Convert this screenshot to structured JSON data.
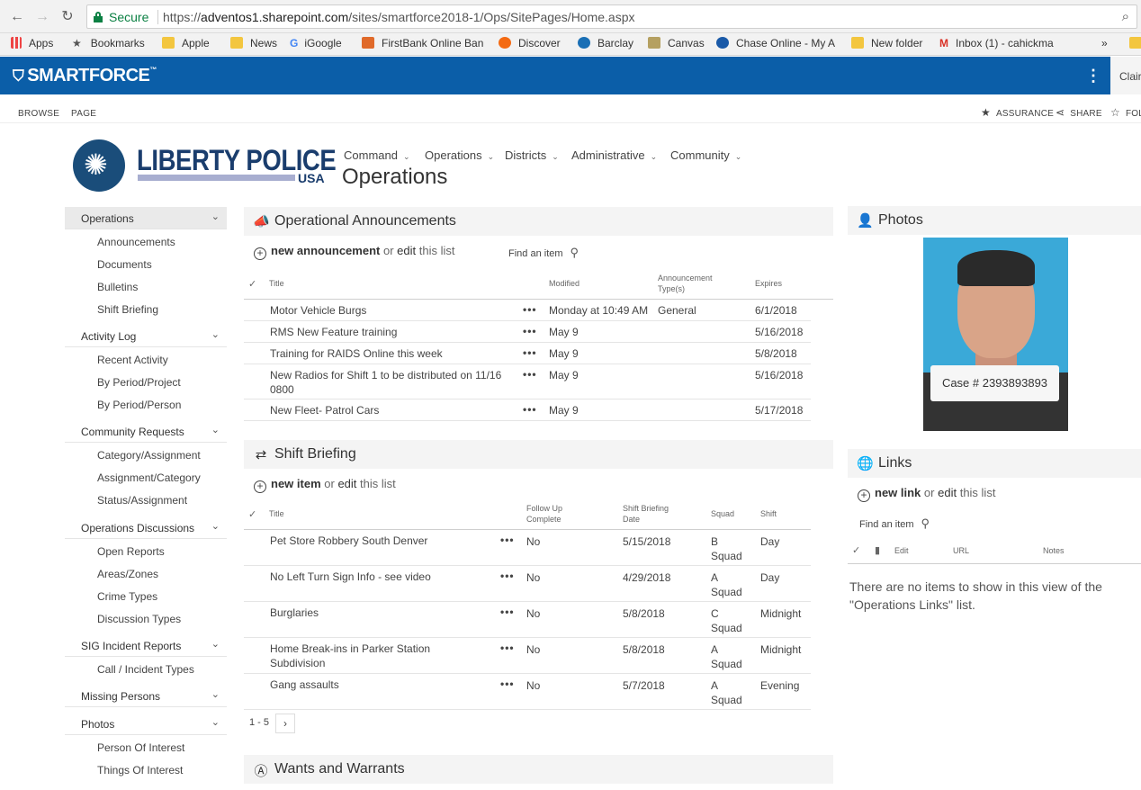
{
  "browser": {
    "secure_label": "Secure",
    "url_prefix": "https://",
    "url_host": "adventos1.sharepoint.com",
    "url_path": "/sites/smartforce2018-1/Ops/SitePages/Home.aspx",
    "bookmarks": [
      "Apps",
      "Bookmarks",
      "Apple",
      "News",
      "iGoogle",
      "FirstBank Online Ban",
      "Discover",
      "Barclay",
      "Canvas",
      "Chase Online - My A",
      "New folder",
      "Inbox (1) - cahickma"
    ],
    "more": "»"
  },
  "suite": {
    "brand": "SMARTFORCE",
    "tm": "™",
    "user": "Clair"
  },
  "ribbon": {
    "tabs": [
      "BROWSE",
      "PAGE"
    ],
    "actions": [
      "ASSURANCE",
      "SHARE",
      "FOL"
    ]
  },
  "header": {
    "logo_main": "LIBERTY POLICE",
    "logo_sub": "USA",
    "nav": [
      "Command",
      "Operations",
      "Districts",
      "Administrative",
      "Community"
    ],
    "site_title": "Operations"
  },
  "leftnav": {
    "sections": [
      {
        "label": "Operations",
        "items": [
          "Announcements",
          "Documents",
          "Bulletins",
          "Shift Briefing"
        ]
      },
      {
        "label": "Activity Log",
        "items": [
          "Recent Activity",
          "By Period/Project",
          "By Period/Person"
        ]
      },
      {
        "label": "Community Requests",
        "items": [
          "Category/Assignment",
          "Assignment/Category",
          "Status/Assignment"
        ]
      },
      {
        "label": "Operations Discussions",
        "items": [
          "Open Reports",
          "Areas/Zones",
          "Crime Types",
          "Discussion Types"
        ]
      },
      {
        "label": "SIG Incident Reports",
        "items": [
          "Call / Incident Types"
        ]
      },
      {
        "label": "Missing Persons",
        "items": []
      },
      {
        "label": "Photos",
        "items": [
          "Person Of Interest",
          "Things Of Interest"
        ]
      }
    ]
  },
  "announcements": {
    "title": "Operational Announcements",
    "new_label": "new announcement",
    "or": "or",
    "edit": "edit",
    "this_list": "this list",
    "find": "Find an item",
    "columns": [
      "Title",
      "Modified",
      "Announcement Type(s)",
      "Expires"
    ],
    "rows": [
      {
        "title": "Motor Vehicle Burgs",
        "modified": "Monday at 10:49 AM",
        "type": "General",
        "expires": "6/1/2018"
      },
      {
        "title": "RMS New Feature training",
        "modified": "May 9",
        "type": "",
        "expires": "5/16/2018"
      },
      {
        "title": "Training for RAIDS Online this week",
        "modified": "May 9",
        "type": "",
        "expires": "5/8/2018"
      },
      {
        "title": "New Radios for Shift 1 to be distributed on 11/16 0800",
        "modified": "May 9",
        "type": "",
        "expires": "5/16/2018"
      },
      {
        "title": "New Fleet- Patrol Cars",
        "modified": "May 9",
        "type": "",
        "expires": "5/17/2018"
      }
    ]
  },
  "shift": {
    "title": "Shift Briefing",
    "new_label": "new item",
    "or": "or",
    "edit": "edit",
    "this_list": "this list",
    "columns": [
      "Title",
      "Follow Up Complete",
      "Shift Briefing Date",
      "Squad",
      "Shift"
    ],
    "rows": [
      {
        "title": "Pet Store Robbery South Denver",
        "follow": "No",
        "date": "5/15/2018",
        "squad": "B Squad",
        "shift": "Day"
      },
      {
        "title": "No Left Turn Sign Info - see video",
        "follow": "No",
        "date": "4/29/2018",
        "squad": "A Squad",
        "shift": "Day"
      },
      {
        "title": "Burglaries",
        "follow": "No",
        "date": "5/8/2018",
        "squad": "C Squad",
        "shift": "Midnight"
      },
      {
        "title": "Home Break-ins in Parker Station Subdivision",
        "follow": "No",
        "date": "5/8/2018",
        "squad": "A Squad",
        "shift": "Midnight"
      },
      {
        "title": "Gang assaults",
        "follow": "No",
        "date": "5/7/2018",
        "squad": "A Squad",
        "shift": "Evening"
      }
    ],
    "pager": "1 - 5",
    "next": "›"
  },
  "wants": {
    "title": "Wants and Warrants"
  },
  "photos": {
    "title": "Photos",
    "caption": "Case # 2393893893"
  },
  "links": {
    "title": "Links",
    "new_label": "new link",
    "or": "or",
    "edit": "edit",
    "this_list": "this list",
    "find": "Find an item",
    "columns": [
      "Edit",
      "URL",
      "Notes"
    ],
    "empty": "There are no items to show in this view of the \"Operations Links\" list."
  },
  "colors": {
    "suitebar": "#0b5ea8",
    "secure": "#0b8043",
    "logo": "#1a3d6d"
  }
}
